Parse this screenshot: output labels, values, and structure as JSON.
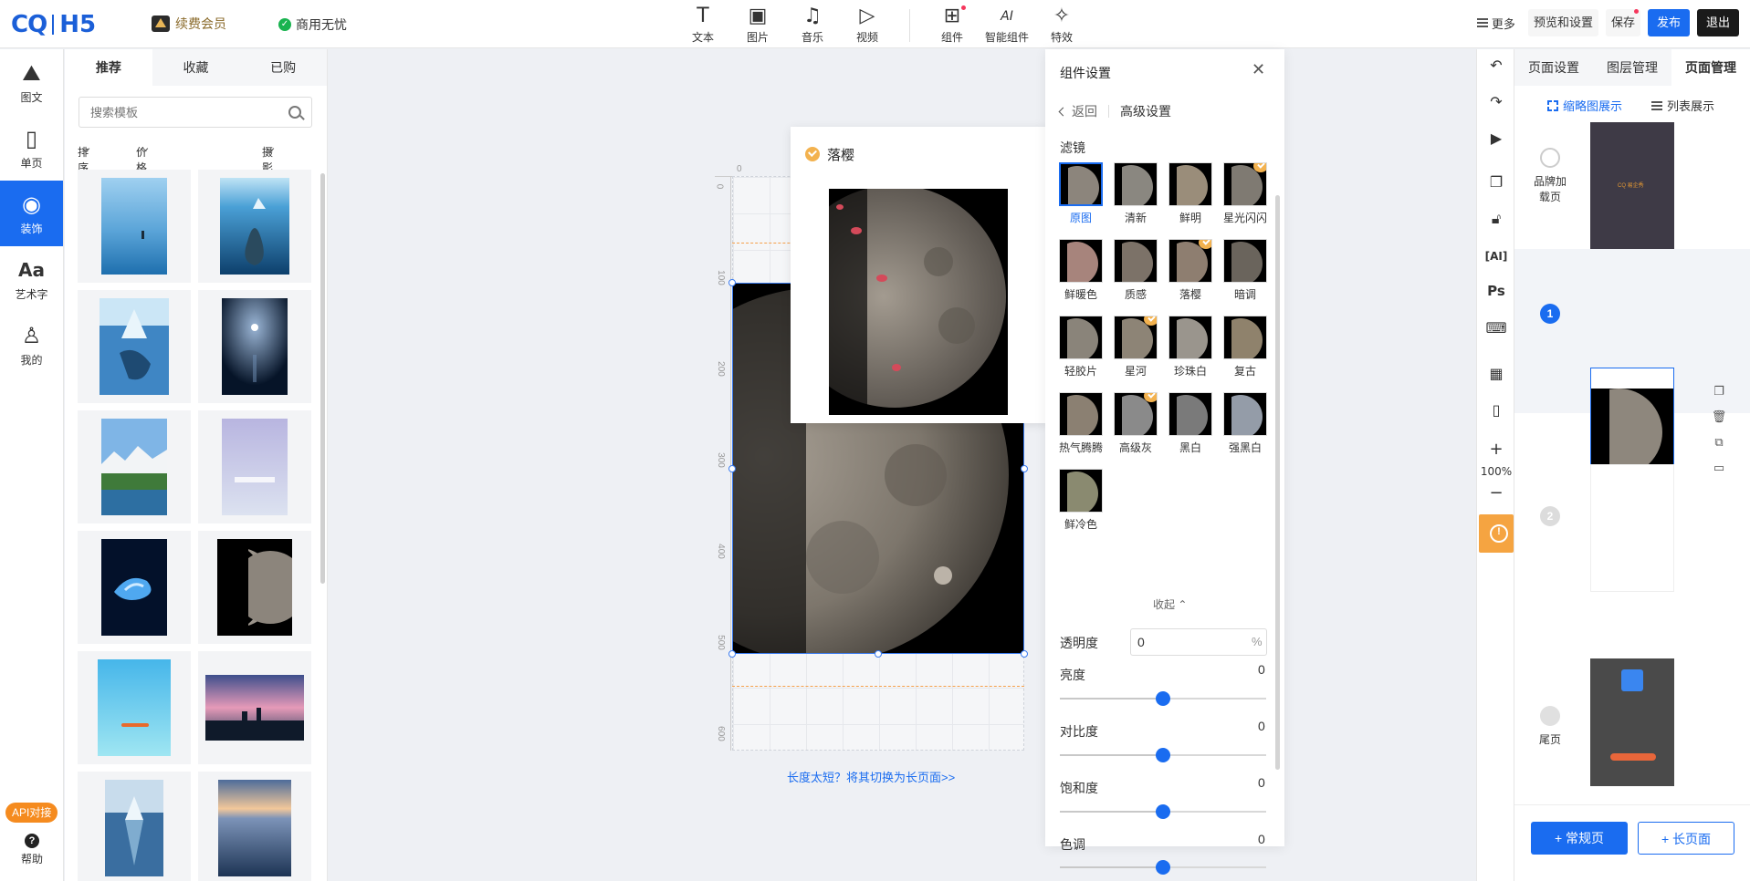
{
  "header": {
    "logo_mark": "CQ",
    "logo_product": "H5",
    "vip_label": "续费会员",
    "commercial_label": "商用无忧",
    "tools": [
      {
        "icon": "text-icon",
        "glyph": "T",
        "label": "文本"
      },
      {
        "icon": "image-icon",
        "glyph": "▣",
        "label": "图片"
      },
      {
        "icon": "music-icon",
        "glyph": "♫",
        "label": "音乐"
      },
      {
        "icon": "video-icon",
        "glyph": "▷",
        "label": "视频"
      },
      {
        "icon": "component-icon",
        "glyph": "⊞",
        "label": "组件"
      },
      {
        "icon": "ai-component-icon",
        "glyph": "AI",
        "label": "智能组件"
      },
      {
        "icon": "effects-icon",
        "glyph": "✧",
        "label": "特效"
      }
    ],
    "more_label": "更多",
    "preview_label": "预览和设置",
    "save_label": "保存",
    "publish_label": "发布",
    "exit_label": "退出"
  },
  "rail": {
    "items": [
      {
        "icon": "mountain-icon",
        "glyph": "⛰",
        "label": "图文"
      },
      {
        "icon": "phone-page-icon",
        "glyph": "▯",
        "label": "单页"
      },
      {
        "icon": "palette-icon",
        "glyph": "◉",
        "label": "装饰",
        "active": true
      },
      {
        "icon": "art-text-icon",
        "glyph": "Aa",
        "label": "艺术字"
      },
      {
        "icon": "user-icon",
        "glyph": "♙",
        "label": "我的"
      }
    ],
    "api_label": "API对接",
    "help_label": "帮助"
  },
  "templates": {
    "tabs": [
      "推荐",
      "收藏",
      "已购"
    ],
    "search_placeholder": "搜索模板",
    "filters": {
      "sort": "排序",
      "price": "价格",
      "category": "摄影图"
    }
  },
  "canvas": {
    "ruler_top_zero": "0",
    "ruler_left": [
      "0",
      "100",
      "200",
      "300",
      "400",
      "500",
      "600"
    ],
    "switch_hint": "长度太短？将其切换为长页面>>"
  },
  "preview_popup": {
    "name": "落樱"
  },
  "settings": {
    "title": "组件设置",
    "back_label": "返回",
    "advanced_label": "高级设置",
    "filter_title": "滤镜",
    "filters": [
      {
        "label": "原图",
        "selected": true,
        "vip": false
      },
      {
        "label": "清新",
        "vip": false
      },
      {
        "label": "鲜明",
        "vip": false
      },
      {
        "label": "星光闪闪",
        "vip": true
      },
      {
        "label": "鲜暖色",
        "vip": false
      },
      {
        "label": "质感",
        "vip": false
      },
      {
        "label": "落樱",
        "vip": true
      },
      {
        "label": "暗调",
        "vip": false
      },
      {
        "label": "轻胶片",
        "vip": false
      },
      {
        "label": "星河",
        "vip": true
      },
      {
        "label": "珍珠白",
        "vip": false
      },
      {
        "label": "复古",
        "vip": false
      },
      {
        "label": "热气腾腾",
        "vip": false
      },
      {
        "label": "高级灰",
        "vip": true
      },
      {
        "label": "黑白",
        "vip": false
      },
      {
        "label": "强黑白",
        "vip": false
      },
      {
        "label": "鲜冷色",
        "vip": false
      }
    ],
    "collapse_label": "收起",
    "opacity": {
      "label": "透明度",
      "value": "0",
      "unit": "%"
    },
    "brightness": {
      "label": "亮度",
      "value": "0",
      "level": 0.5
    },
    "contrast": {
      "label": "对比度",
      "value": "0",
      "level": 0.5
    },
    "saturation": {
      "label": "饱和度",
      "value": "0",
      "level": 0.5
    },
    "hue": {
      "label": "色调",
      "value": "0",
      "level": 0.5
    }
  },
  "vtools": {
    "zoom": "100%"
  },
  "pages": {
    "tabs": [
      "页面设置",
      "图层管理",
      "页面管理"
    ],
    "view_thumb": "缩略图展示",
    "view_list": "列表展示",
    "items": [
      {
        "number": "",
        "label": "品牌加载页"
      },
      {
        "number": "1",
        "label": ""
      },
      {
        "number": "2",
        "label": ""
      },
      {
        "number": "",
        "label": "尾页"
      }
    ],
    "brand_logo_text": "CQ 易企秀",
    "add_normal": "+ 常规页",
    "add_long": "+ 长页面"
  },
  "colors": {
    "accent": "#1a6cf0",
    "vip_gold": "#f3b24f",
    "warning": "#f5a441"
  }
}
